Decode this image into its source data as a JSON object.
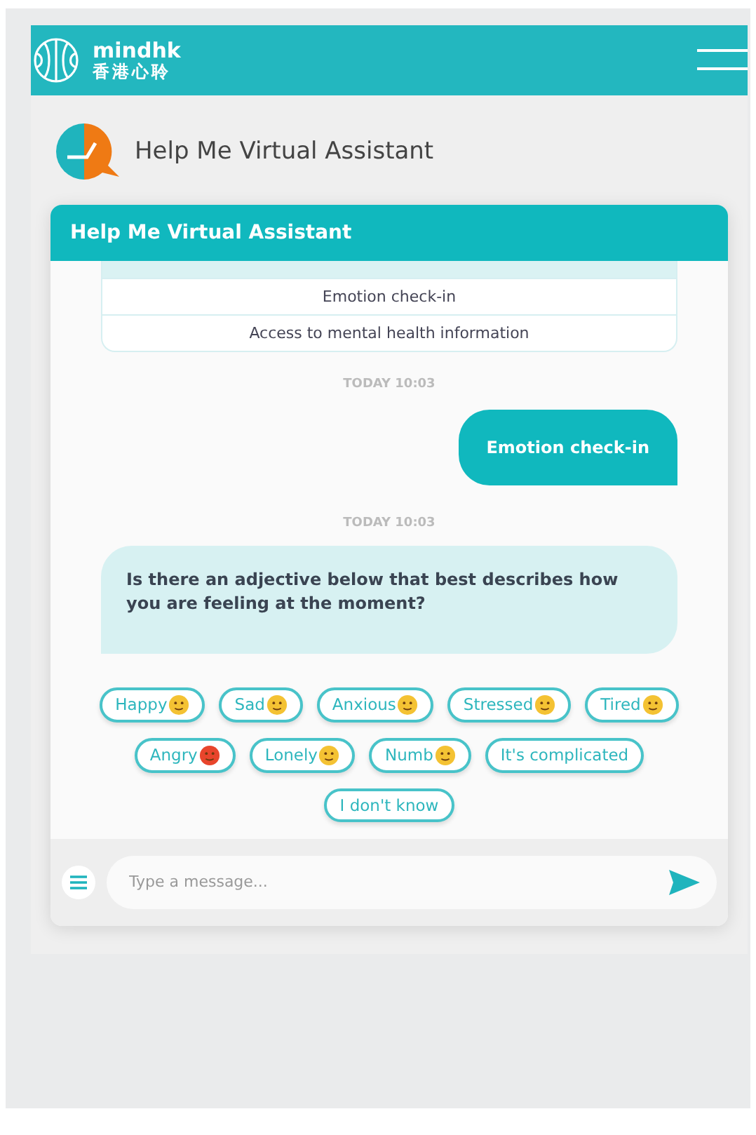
{
  "header": {
    "brand": "mindhk",
    "brand_chinese": "香港心聆"
  },
  "page_title": "Help Me Virtual Assistant",
  "chat": {
    "title": "Help Me Virtual Assistant",
    "messages": [
      {
        "kind": "options",
        "options": [
          "Emotion check-in",
          "Access to mental health information"
        ]
      },
      {
        "kind": "timestamp",
        "text": "TODAY 10:03"
      },
      {
        "kind": "user",
        "text": "Emotion check-in"
      },
      {
        "kind": "timestamp",
        "text": "TODAY 10:03"
      },
      {
        "kind": "bot",
        "text": "Is there an adjective below that best describes how you are feeling at the moment?"
      }
    ],
    "quick_replies": [
      {
        "label": "Happy",
        "color": "#f4c233"
      },
      {
        "label": "Sad",
        "color": "#f4c233"
      },
      {
        "label": "Anxious",
        "color": "#f4c233"
      },
      {
        "label": "Stressed",
        "color": "#f4c233"
      },
      {
        "label": "Tired",
        "color": "#f4c233"
      },
      {
        "label": "Angry",
        "color": "#e8452c"
      },
      {
        "label": "Lonely",
        "color": "#f4c233"
      },
      {
        "label": "Numb",
        "color": "#f4c233"
      },
      {
        "label": "It's complicated"
      },
      {
        "label": "I don't know"
      }
    ],
    "composer": {
      "placeholder": "Type a message..."
    }
  }
}
